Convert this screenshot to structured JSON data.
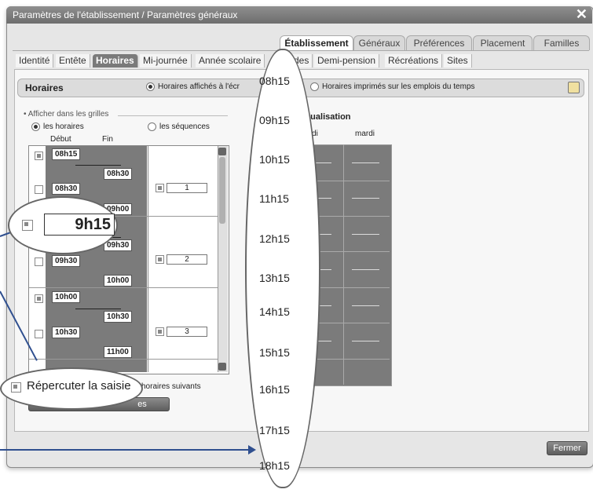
{
  "window": {
    "title": "Paramètres de l'établissement / Paramètres généraux",
    "close_glyph": "✕"
  },
  "main_tabs": [
    {
      "label": "Établissement",
      "active": true
    },
    {
      "label": "Généraux",
      "active": false
    },
    {
      "label": "Préférences",
      "active": false
    },
    {
      "label": "Placement",
      "active": false
    },
    {
      "label": "Familles",
      "active": false
    }
  ],
  "sub_tabs": [
    {
      "label": "Identité",
      "active": false
    },
    {
      "label": "Entête",
      "active": false
    },
    {
      "label": "Horaires",
      "active": true
    },
    {
      "label": "Mi-journée",
      "active": false
    },
    {
      "label": "Année scolaire",
      "active": false
    },
    {
      "label": "des",
      "active": false
    },
    {
      "label": "Demi-pension",
      "active": false
    },
    {
      "label": "Récréations",
      "active": false
    },
    {
      "label": "Sites",
      "active": false
    }
  ],
  "horaires_panel": {
    "title": "Horaires",
    "radio_screen": "Horaires affichés à l'écr",
    "radio_print": "Horaires imprimés sur les emplois du temps",
    "icon": "printer-icon"
  },
  "grid_options": {
    "label": "Afficher dans les grilles",
    "radio_horaires": "les horaires",
    "radio_sequences": "les séquences",
    "col_debut": "Début",
    "col_fin": "Fin"
  },
  "time_rows": [
    {
      "start": "08h15",
      "end": "08h30"
    },
    {
      "start": "08h30",
      "end": "09h00"
    },
    {
      "start": "9h15",
      "end": "09h30"
    },
    {
      "start": "09h30",
      "end": "10h00"
    },
    {
      "start": "10h00",
      "end": "10h30"
    },
    {
      "start": "10h30",
      "end": "11h00"
    }
  ],
  "sequence_numbers": [
    "1",
    "2",
    "3"
  ],
  "visualisation": {
    "title": "isualisation",
    "days": [
      "undi",
      "mardi"
    ]
  },
  "repeat_checkbox": {
    "label": "Répercuter la saisie",
    "suffix": "horaires suivants"
  },
  "hidden_button_fragment": "es",
  "close_button": "Fermer",
  "ruler_times": [
    "08h15",
    "09h15",
    "10h15",
    "11h15",
    "12h15",
    "13h15",
    "14h15",
    "15h15",
    "16h15",
    "17h15",
    "18h15"
  ]
}
